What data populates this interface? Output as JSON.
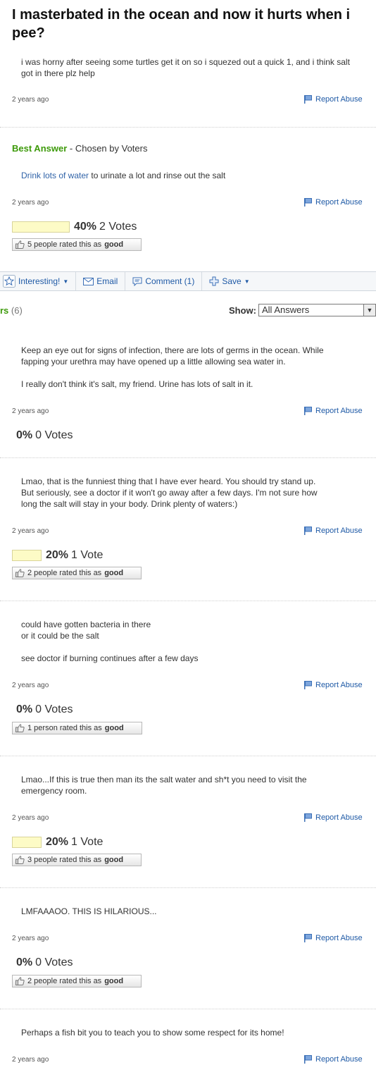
{
  "question": {
    "title": "I masterbated in the ocean and now it hurts when i pee?",
    "body": "i was horny after seeing some turtles get it on so i squezed out a quick 1, and i think salt got in there plz help",
    "time": "2 years ago"
  },
  "report_label": "Report Abuse",
  "best_answer": {
    "heading": "Best Answer",
    "chosen_by": "- Chosen by Voters",
    "link_text": "Drink lots of water",
    "rest_text": " to urinate a lot and rinse out the salt",
    "time": "2 years ago",
    "percent": "40%",
    "votes": "2 Votes",
    "percent_value": 40,
    "rated_text": "5 people rated this as",
    "rated_bold": "good"
  },
  "toolbar": {
    "interesting": "Interesting!",
    "email": "Email",
    "comment": "Comment (1)",
    "save": "Save"
  },
  "answers_header": {
    "label": "rs",
    "count": "(6)",
    "show_label": "Show:",
    "filter_value": "All Answers"
  },
  "answers": [
    {
      "lines": [
        "Keep an eye out for signs of infection, there are lots of germs in the ocean. While",
        "fapping your urethra may have opened up a little allowing sea water in.",
        "",
        "I really don't think it's salt, my friend. Urine has lots of salt in it."
      ],
      "time": "2 years ago",
      "percent": "0%",
      "votes": "0 Votes",
      "percent_value": 0
    },
    {
      "lines": [
        "Lmao, that is the funniest thing that I have ever heard. You should try stand up.",
        "But seriously, see a doctor if it won't go away after a few days. I'm not sure how",
        "long the salt will stay in your body. Drink plenty of waters:)"
      ],
      "time": "2 years ago",
      "percent": "20%",
      "votes": "1 Vote",
      "percent_value": 20,
      "rated_text": "2 people rated this as",
      "rated_bold": "good"
    },
    {
      "lines": [
        "could have gotten bacteria in there",
        "or it could be the salt",
        "",
        "see doctor if burning continues after a few days"
      ],
      "time": "2 years ago",
      "percent": "0%",
      "votes": "0 Votes",
      "percent_value": 0,
      "rated_text": "1 person rated this as",
      "rated_bold": "good"
    },
    {
      "lines": [
        "Lmao...If this is true then man its the salt water and sh*t you need to visit the",
        "emergency room."
      ],
      "time": "2 years ago",
      "percent": "20%",
      "votes": "1 Vote",
      "percent_value": 20,
      "rated_text": "3 people rated this as",
      "rated_bold": "good"
    },
    {
      "lines": [
        "LMFAAAOO. THIS IS HILARIOUS..."
      ],
      "time": "2 years ago",
      "percent": "0%",
      "votes": "0 Votes",
      "percent_value": 0,
      "rated_text": "2 people rated this as",
      "rated_bold": "good"
    },
    {
      "lines": [
        "Perhaps a fish bit you to teach you to show some respect for its home!"
      ],
      "time": "2 years ago"
    }
  ],
  "colors": {
    "link": "#3063a8",
    "best_green": "#3d9a0a",
    "vote_bar": "#fdfbc6"
  },
  "icons": [
    "flag-icon",
    "thumb-up-icon",
    "star-icon",
    "email-icon",
    "comment-icon",
    "plus-icon",
    "chevron-down-icon"
  ]
}
